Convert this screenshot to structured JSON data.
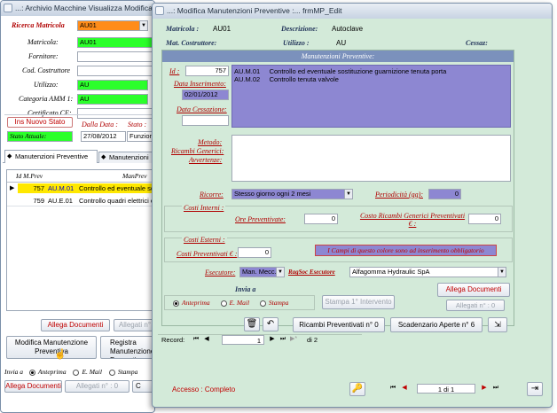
{
  "back_window": {
    "title": "...: Archivio Macchine Visualizza Modifica :...",
    "search_label": "Ricerca Matricola",
    "search_value": "AU01",
    "fields": [
      {
        "label": "Matricola:",
        "value": "AU01"
      },
      {
        "label": "Fornitore:",
        "value": ""
      },
      {
        "label": "Cod. Costruttore",
        "value": ""
      },
      {
        "label": "Utilizzo:",
        "value": "AU"
      },
      {
        "label": "Categoria AMM 1:",
        "value": "AU"
      },
      {
        "label": "Certificato CE:",
        "value": ""
      }
    ],
    "ins_stato_button": "Ins Nuovo Stato",
    "stato_attuale_label": "Stato Attuale:",
    "dalla_data_label": "Dalla Data :",
    "dalla_data_value": "27/08/2012",
    "stato_label": "Stato :",
    "stato_value": "Funzion",
    "tabs": [
      "Manutenzioni Preventive",
      "Manutenzioni"
    ],
    "columns": [
      "Id M.Prev",
      "ManPrev"
    ],
    "rows": [
      {
        "id": "757",
        "code": "AU.M.01",
        "desc": "Controllo ed eventuale sos"
      },
      {
        "id": "759",
        "code": "AU.E.01",
        "desc": "Controllo quadri elettrici e"
      }
    ],
    "allega_documenti": "Allega Documenti",
    "allegati_n": "Allegati n°",
    "modifica_button": "Modifica Manutenzione Preventiva",
    "registra_button": "Registra Manutenzione Preventiva",
    "invia_label": "Invia a",
    "radio_options": [
      "Anteprima",
      "E. Mail",
      "Stampa"
    ],
    "allega_documenti_2": "Allega Documenti",
    "allegati_n2": "Allegati n° : 0",
    "c_btn": "C"
  },
  "front_window": {
    "title": "...: Modifica Manutenzioni Preventive :...   frmMP_Edit",
    "matricola_label": "Matricola :",
    "matricola_value": "AU01",
    "descrizione_label": "Descrizione:",
    "descrizione_value": "Autoclave",
    "mat_costruttore_label": "Mat. Costruttore:",
    "utilizzo_label": "Utilizzo :",
    "utilizzo_value": "AU",
    "cessaz_label": "Cessaz:",
    "section_title": "Manutenzioni Preventive:",
    "id_label": "Id :",
    "id_value": "757",
    "data_inserimento_label": "Data Inserimento:",
    "data_inserimento_value": "02/01/2012",
    "data_cessazione_label": "Data Cessazione:",
    "data_cessazione_value": "",
    "description_lines": [
      "AU.M.01     Controllo ed eventuale sostituzione guarnizione tenuta porta",
      "AU.M.02     Controllo tenuta valvole"
    ],
    "metodo_label": "Metodo:",
    "ricambi_label": "Ricambi Generici:",
    "avvertenze_label": "Avvertenze:",
    "ricorre_label": "Ricorre:",
    "ricorre_value": "Stesso giorno  ogni 2 mesi",
    "periodicita_label": "Periodicità (gg):",
    "periodicita_value": "0",
    "costi_interni_label": "Costi Interni :",
    "ore_preventivate_label": "Ore Preventivate:",
    "ore_preventivate_value": "0",
    "costo_ricambi_label": "Costo Ricambi Generici Preventivati € :",
    "costo_ricambi_value": "0",
    "costi_esterni_label": "Costi Esterni :",
    "costi_preventivati_label": "Costi Preventivati € :",
    "costi_preventivati_value": "0",
    "note_obbligatori": "I Campi di questo colore sono ad inserimento obbligatorio",
    "esecutore_label": "Esecutore:",
    "esecutore_value": "Man. Mecc.",
    "ragsoc_label": "RagSoc Esecutore",
    "ragsoc_value": "Alfagomma Hydraulic SpA",
    "invia_label": "Invia a",
    "radio_options": [
      "Anteprima",
      "E. Mail",
      "Stampa"
    ],
    "stampa_button": "Stampa 1° Intervento",
    "allega_button": "Allega Documenti",
    "allegati_label": "Allegati n° : 0",
    "ricambi_button": "Ricambi Preventivati n° 0",
    "scadenzario_button": "Scadenzario Aperte n° 6",
    "record_label": "Record:",
    "record_value": "1",
    "record_of": "di 2",
    "accesso_label": "Accesso : Completo",
    "pager_value": "1 di 1"
  }
}
